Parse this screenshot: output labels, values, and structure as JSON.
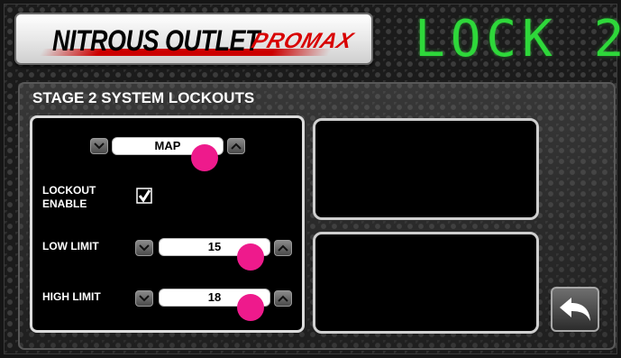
{
  "header": {
    "brand": "NITROUS OUTLET",
    "brand_sub": "PROMAX",
    "lock_code": "LOCK 2"
  },
  "section": {
    "title": "STAGE 2 SYSTEM LOCKOUTS"
  },
  "lockout": {
    "source": "MAP",
    "enable_label": "LOCKOUT\nENABLE",
    "enabled": true,
    "low_limit_label": "LOW LIMIT",
    "low_limit_value": "15",
    "high_limit_label": "HIGH LIMIT",
    "high_limit_value": "18"
  },
  "icons": {
    "down": "chevron-down-icon",
    "up": "chevron-up-icon",
    "back": "back-arrow-icon",
    "check": "checkmark-icon"
  },
  "colors": {
    "lock_text": "#2ed83a",
    "brand_accent": "#d80000",
    "touch_marker": "#ee1a8c"
  }
}
